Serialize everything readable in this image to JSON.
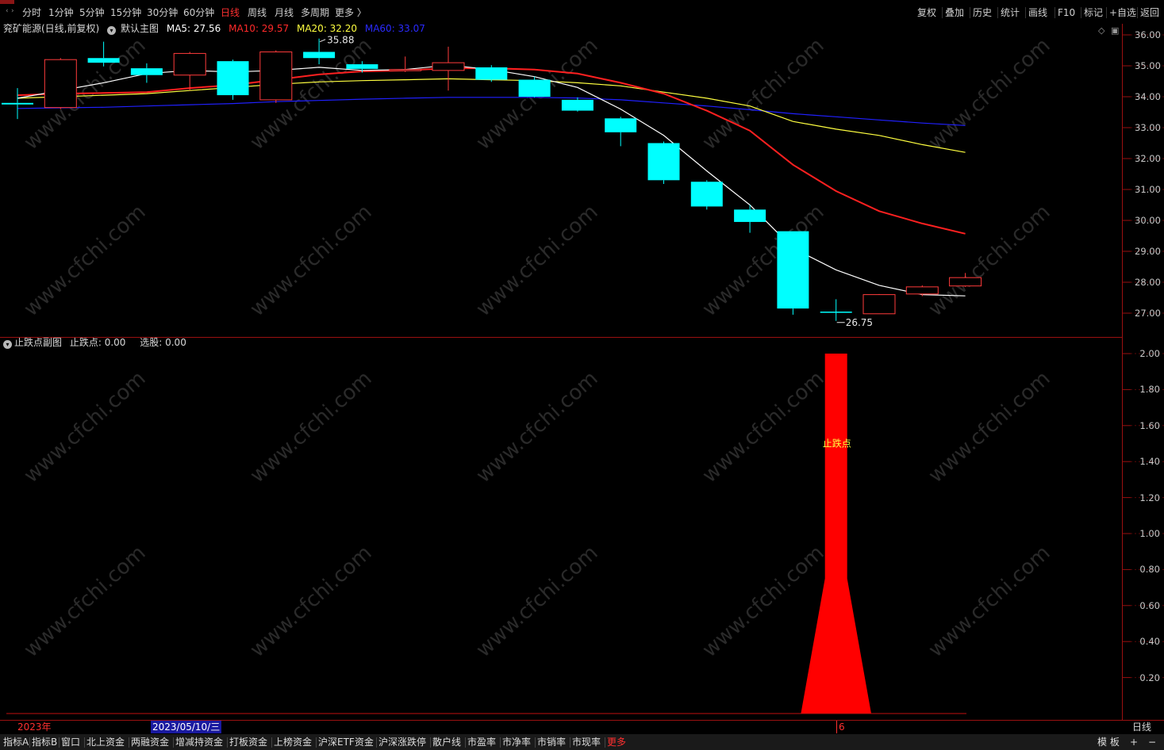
{
  "toolbar": {
    "timeframes": [
      "分时",
      "1分钟",
      "5分钟",
      "15分钟",
      "30分钟",
      "60分钟",
      "日线",
      "周线",
      "月线",
      "多周期",
      "更多 〉"
    ],
    "active_timeframe": "日线",
    "right_buttons": [
      "复权",
      "叠加",
      "历史",
      "统计",
      "画线",
      "F10",
      "标记",
      "+自选",
      "返回"
    ]
  },
  "main_header": {
    "title": "兖矿能源(日线,前复权)",
    "template": "默认主图",
    "ma5": "MA5: 27.56",
    "ma10": "MA10: 29.57",
    "ma20": "MA20: 32.20",
    "ma60": "MA60: 33.07"
  },
  "price_axis": [
    "36.00",
    "35.00",
    "34.00",
    "33.00",
    "32.00",
    "31.00",
    "30.00",
    "29.00",
    "28.00",
    "27.00"
  ],
  "annotations": {
    "high": "35.88",
    "low": "26.75"
  },
  "sub_header": {
    "name": "止跌点副图",
    "stop_label": "止跌点: 0.00",
    "pick_label": "选股: 0.00"
  },
  "sub_axis": [
    "2.00",
    "1.80",
    "1.60",
    "1.40",
    "1.20",
    "1.00",
    "0.80",
    "0.60",
    "0.40",
    "0.20"
  ],
  "signal_text": "止跌点",
  "date_bar": {
    "year": "2023年",
    "cursor_date": "2023/05/10/三",
    "month_mark": "6",
    "period": "日线"
  },
  "bottom_tabs": [
    "指标A",
    "指标B",
    "窗口",
    "北上资金",
    "两融资金",
    "增减持资金",
    "打板资金",
    "上榜资金",
    "沪深ETF资金",
    "沪深涨跌停",
    "散户线",
    "市盈率",
    "市净率",
    "市销率",
    "市现率",
    "更多"
  ],
  "bottom_right": [
    "模 板",
    "+",
    "−"
  ],
  "watermark": "www.cfchi.com",
  "colors": {
    "up": "#ff3b3b",
    "down": "#00ffff",
    "ma5": "#ffffff",
    "ma10": "#ff2020",
    "ma20": "#ffff40",
    "ma60": "#2020ff",
    "signal": "#ff0000"
  },
  "chart_data": {
    "type": "candlestick",
    "ylim": [
      26.5,
      36.2
    ],
    "candles": [
      {
        "o": 33.8,
        "c": 33.75,
        "h": 34.28,
        "l": 33.28
      },
      {
        "o": 33.65,
        "c": 35.2,
        "h": 35.25,
        "l": 33.6
      },
      {
        "o": 35.25,
        "c": 35.1,
        "h": 35.78,
        "l": 34.98
      },
      {
        "o": 34.92,
        "c": 34.7,
        "h": 35.08,
        "l": 34.45
      },
      {
        "o": 34.7,
        "c": 35.4,
        "h": 35.45,
        "l": 34.2
      },
      {
        "o": 35.15,
        "c": 34.05,
        "h": 35.2,
        "l": 33.9
      },
      {
        "o": 33.9,
        "c": 35.45,
        "h": 35.5,
        "l": 33.8
      },
      {
        "o": 35.45,
        "c": 35.25,
        "h": 35.88,
        "l": 35.05
      },
      {
        "o": 35.05,
        "c": 34.9,
        "h": 35.15,
        "l": 34.78
      },
      {
        "o": 34.88,
        "c": 34.88,
        "h": 35.3,
        "l": 34.8
      },
      {
        "o": 34.85,
        "c": 35.1,
        "h": 35.62,
        "l": 34.2
      },
      {
        "o": 34.95,
        "c": 34.55,
        "h": 35.02,
        "l": 34.48
      },
      {
        "o": 34.55,
        "c": 34.0,
        "h": 34.65,
        "l": 33.98
      },
      {
        "o": 33.9,
        "c": 33.55,
        "h": 33.98,
        "l": 33.52
      },
      {
        "o": 33.3,
        "c": 32.85,
        "h": 33.35,
        "l": 32.4
      },
      {
        "o": 32.5,
        "c": 31.3,
        "h": 32.55,
        "l": 31.18
      },
      {
        "o": 31.25,
        "c": 30.45,
        "h": 31.3,
        "l": 30.35
      },
      {
        "o": 30.35,
        "c": 29.95,
        "h": 30.5,
        "l": 29.6
      },
      {
        "o": 29.65,
        "c": 27.15,
        "h": 29.65,
        "l": 26.95
      },
      {
        "o": 27.05,
        "c": 27.02,
        "h": 27.45,
        "l": 26.75
      },
      {
        "o": 26.98,
        "c": 27.6,
        "h": 27.62,
        "l": 26.98
      },
      {
        "o": 27.62,
        "c": 27.85,
        "h": 27.9,
        "l": 27.55
      },
      {
        "o": 27.88,
        "c": 28.15,
        "h": 28.3,
        "l": 27.85
      }
    ],
    "ma": {
      "MA5": [
        33.95,
        34.2,
        34.45,
        34.75,
        34.85,
        34.8,
        34.85,
        34.95,
        34.85,
        34.88,
        35.02,
        34.88,
        34.65,
        34.3,
        33.6,
        32.75,
        31.6,
        30.5,
        29.1,
        28.4,
        27.9,
        27.6,
        27.56
      ],
      "MA10": [
        34.05,
        34.1,
        34.12,
        34.15,
        34.28,
        34.38,
        34.55,
        34.72,
        34.82,
        34.85,
        34.92,
        34.92,
        34.88,
        34.75,
        34.45,
        34.1,
        33.55,
        32.9,
        31.8,
        30.95,
        30.3,
        29.9,
        29.57
      ],
      "MA20": [
        33.95,
        34.0,
        34.05,
        34.1,
        34.2,
        34.3,
        34.4,
        34.48,
        34.52,
        34.55,
        34.58,
        34.55,
        34.52,
        34.45,
        34.35,
        34.15,
        33.95,
        33.7,
        33.2,
        32.95,
        32.75,
        32.45,
        32.2
      ],
      "MA60": [
        33.62,
        33.64,
        33.66,
        33.7,
        33.74,
        33.78,
        33.84,
        33.88,
        33.92,
        33.95,
        33.98,
        33.98,
        33.98,
        33.96,
        33.9,
        33.8,
        33.7,
        33.58,
        33.45,
        33.35,
        33.25,
        33.15,
        33.07
      ]
    },
    "signal": {
      "index_from": 18,
      "index_to": 20,
      "peak_index": 19,
      "base_value": 0.75,
      "peak_value": 2.0,
      "ylim": [
        0,
        2.05
      ]
    }
  }
}
